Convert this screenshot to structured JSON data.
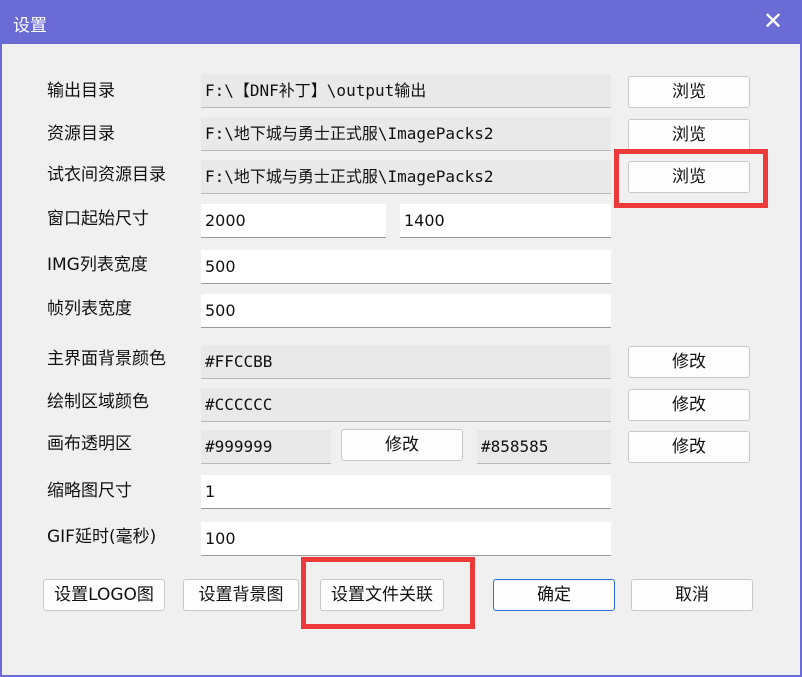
{
  "window": {
    "title": "设置",
    "close_icon": "close-icon"
  },
  "fields": {
    "output_dir": {
      "label": "输出目录",
      "value": "F:\\【DNF补丁】\\output输出",
      "button": "浏览"
    },
    "resource_dir": {
      "label": "资源目录",
      "value": "F:\\地下城与勇士正式服\\ImagePacks2",
      "button": "浏览"
    },
    "fitting_dir": {
      "label": "试衣间资源目录",
      "value": "F:\\地下城与勇士正式服\\ImagePacks2",
      "button": "浏览"
    },
    "window_size": {
      "label": "窗口起始尺寸",
      "width": "2000",
      "height": "1400"
    },
    "img_list_width": {
      "label": "IMG列表宽度",
      "value": "500"
    },
    "frame_list_width": {
      "label": "帧列表宽度",
      "value": "500"
    },
    "main_bg_color": {
      "label": "主界面背景颜色",
      "value": "#FFCCBB",
      "button": "修改"
    },
    "draw_area_color": {
      "label": "绘制区域颜色",
      "value": "#CCCCCC",
      "button": "修改"
    },
    "canvas_transparent": {
      "label": "画布透明区",
      "value1": "#999999",
      "button1": "修改",
      "value2": "#858585",
      "button2": "修改"
    },
    "thumbnail_size": {
      "label": "缩略图尺寸",
      "value": "1"
    },
    "gif_delay": {
      "label": "GIF延时(毫秒)",
      "value": "100"
    }
  },
  "buttons": {
    "set_logo": "设置LOGO图",
    "set_background": "设置背景图",
    "set_file_assoc": "设置文件关联",
    "ok": "确定",
    "cancel": "取消"
  },
  "colors": {
    "titlebar": "#6b6bd6",
    "dialog_bg": "#f0f0f0",
    "highlight": "#ec3a3a",
    "primary_border": "#2f6fd1"
  }
}
